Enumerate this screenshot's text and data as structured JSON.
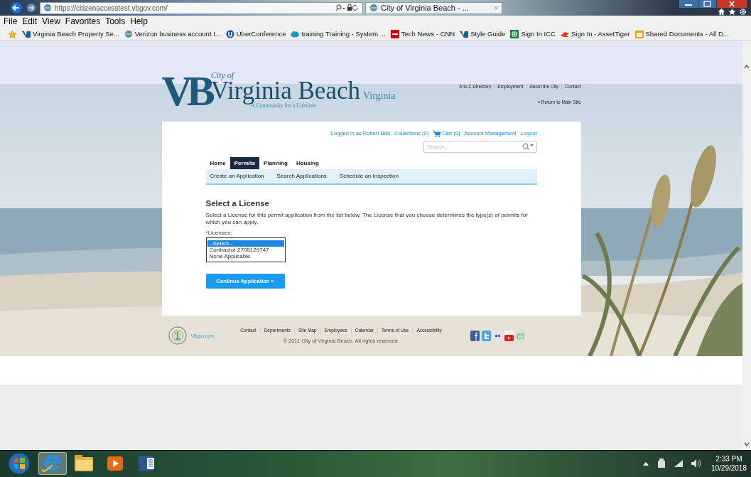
{
  "browser": {
    "address": "https://citizenaccesstest.vbgov.com/",
    "tab_title": "City of Virginia Beach - ...",
    "tab_close": "×",
    "menu": [
      "File",
      "Edit",
      "View",
      "Favorites",
      "Tools",
      "Help"
    ],
    "favorites": [
      {
        "label": "Virginia Beach Property Se...",
        "kind": "vb"
      },
      {
        "label": "Verizon business account I...",
        "kind": "ie"
      },
      {
        "label": "UberConference",
        "kind": "uber"
      },
      {
        "label": "training Training - System ...",
        "kind": "cloud"
      },
      {
        "label": "Tech News - CNN",
        "kind": "cnn"
      },
      {
        "label": "Style Guide",
        "kind": "vb"
      },
      {
        "label": "Sign In ICC",
        "kind": "sheet"
      },
      {
        "label": "Sign In - AssetTiger",
        "kind": "tiger"
      },
      {
        "label": "Shared Documents - All D...",
        "kind": "folder"
      }
    ]
  },
  "site": {
    "logo": {
      "mark": "VB",
      "city_of": "City of",
      "name": "Virginia Beach",
      "state": "Virginia",
      "tagline": "A Community for a Lifetime"
    },
    "top_links": [
      "A to Z Directory",
      "Employment",
      "About the City",
      "Contact"
    ],
    "return_link": "« Return to Main Site",
    "account": {
      "logged_in": "Logged in as:Robert Bills",
      "collections": "Collections (0)",
      "cart": "Cart (0)",
      "management": "Account Management",
      "logout": "Logout"
    },
    "search": {
      "placeholder": "Search..."
    },
    "tabs": [
      {
        "label": "Home",
        "selected": false
      },
      {
        "label": "Permits",
        "selected": true
      },
      {
        "label": "Planning",
        "selected": false
      },
      {
        "label": "Housing",
        "selected": false
      }
    ],
    "subnav": [
      "Create an Application",
      "Search Applications",
      "Schedule an Inspection"
    ],
    "heading": "Select a License",
    "description": "Select a License for this permit application from the list below. The License that you choose determines the type(s) of permits for which you can apply.",
    "field": {
      "label": "Licenses:",
      "required_mark": "*",
      "options": [
        {
          "label": "--Select--",
          "selected": true
        },
        {
          "label": "Contractor 2705129747",
          "selected": false
        },
        {
          "label": "None Applicable",
          "selected": false
        }
      ]
    },
    "continue_button": "Continue Application »",
    "footer": {
      "site_link": "VBgov.com",
      "links": [
        "Contact",
        "Departments",
        "Site Map",
        "Employees",
        "Calendar",
        "Terms of Use",
        "Accessibility"
      ],
      "copyright": "© 2011 City of Virginia Beach. All rights reserved.",
      "social": [
        {
          "kind": "facebook"
        },
        {
          "kind": "twitter"
        },
        {
          "kind": "flickr"
        },
        {
          "kind": "youtube"
        },
        {
          "kind": "email"
        }
      ]
    }
  },
  "taskbar": {
    "apps": [
      {
        "kind": "ie",
        "selected": true
      },
      {
        "kind": "folder",
        "selected": false
      },
      {
        "kind": "media",
        "selected": false
      },
      {
        "kind": "word",
        "selected": false
      }
    ],
    "time": "2:33 PM",
    "date": "10/29/2018"
  }
}
